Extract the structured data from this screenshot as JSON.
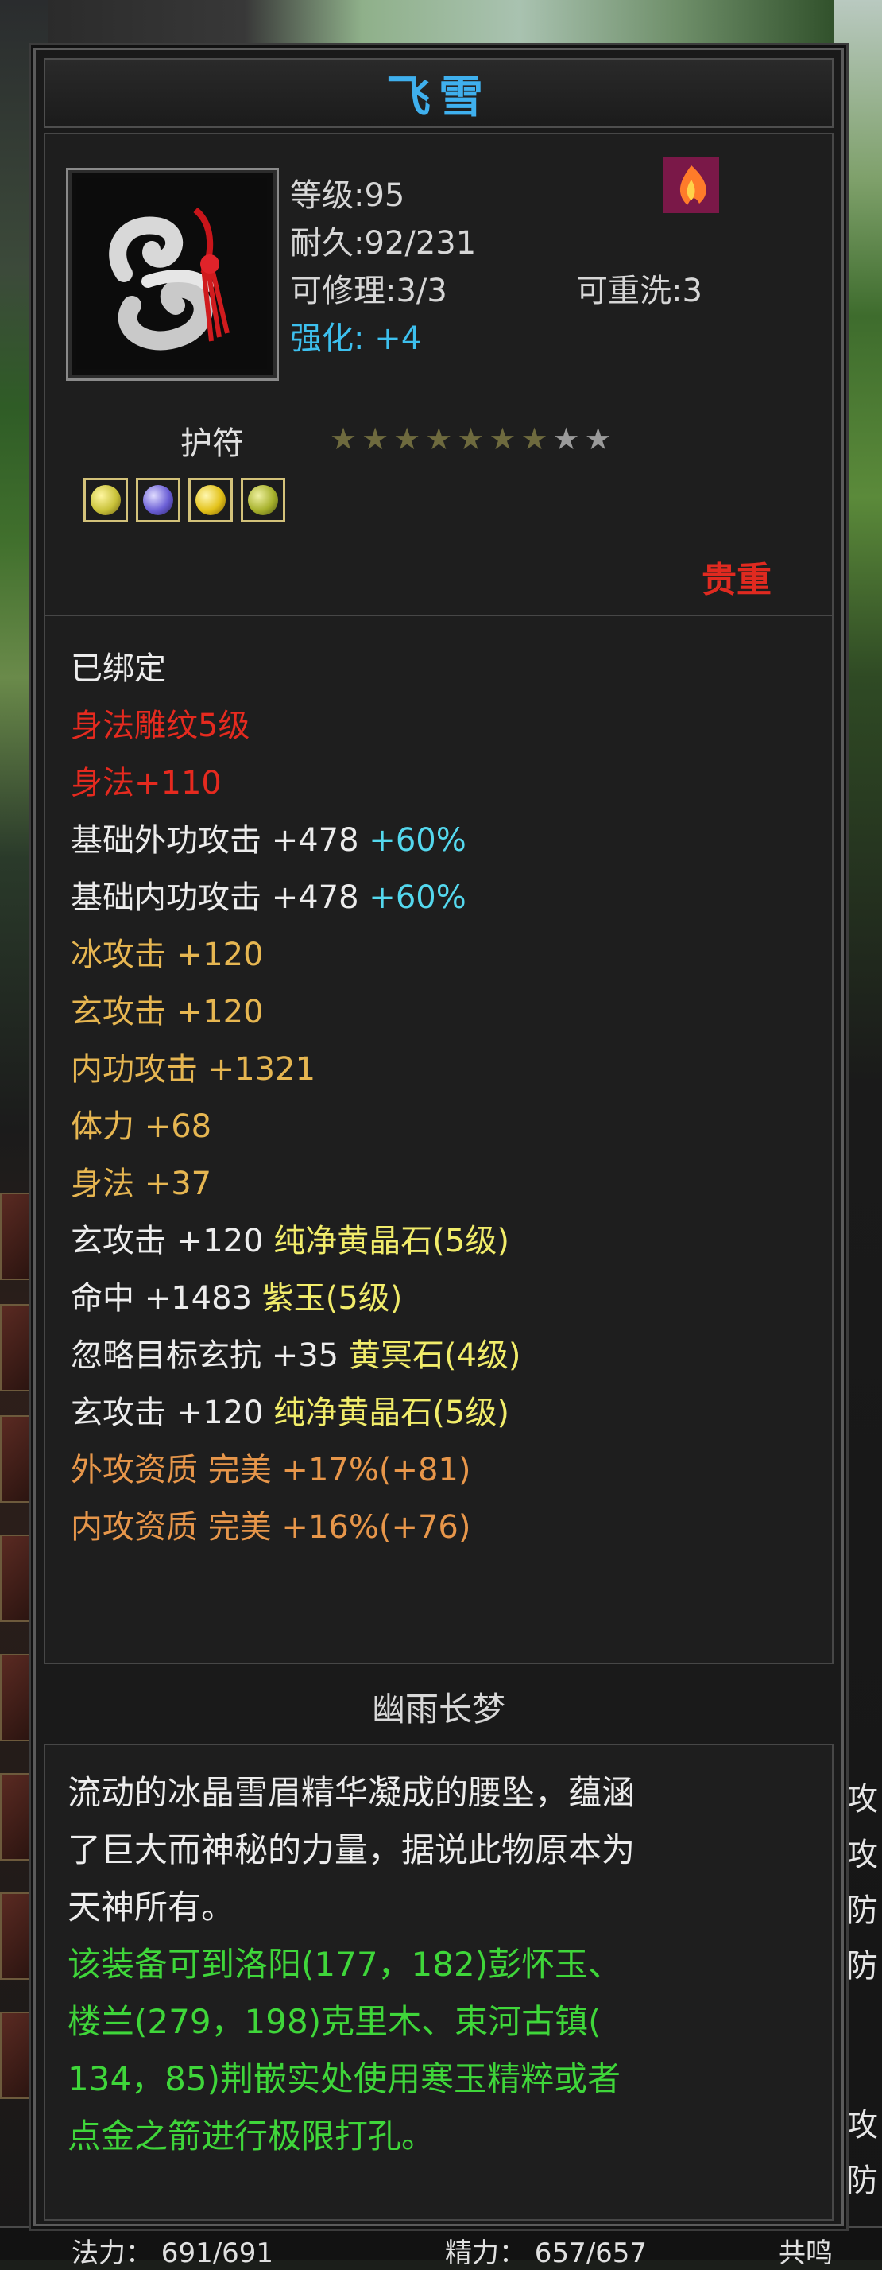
{
  "item": {
    "name": "飞雪",
    "level": "等级:95",
    "durability": "耐久:92/231",
    "repairable": "可修理:3/3",
    "rewashable": "可重洗:3",
    "enhance_label": "强化:",
    "enhance_value": "+4",
    "category": "护符",
    "stars_filled": 7,
    "stars_total": 9,
    "rarity": "贵重",
    "gems": [
      {
        "icon": "yellow-gem-icon",
        "color": "#c9c23a"
      },
      {
        "icon": "purple-gem-icon",
        "color": "#6b5fd6"
      },
      {
        "icon": "gold-gem-icon",
        "color": "#e3c21a"
      },
      {
        "icon": "green-gold-gem-icon",
        "color": "#a7b12c"
      }
    ]
  },
  "attributes": {
    "bound": "已绑定",
    "carving": "身法雕纹5级",
    "carving_bonus": "身法+110",
    "ext_atk": "基础外功攻击 +478",
    "ext_atk_pct": "+60%",
    "int_atk": "基础内功攻击 +478",
    "int_atk_pct": "+60%",
    "ice_atk": "冰攻击 +120",
    "mystic_atk": "玄攻击 +120",
    "inner_atk": "内功攻击 +1321",
    "stamina": "体力 +68",
    "agility": "身法 +37",
    "gem1_stat": "玄攻击 +120",
    "gem1_name": "纯净黄晶石(5级)",
    "gem2_stat": "命中 +1483",
    "gem2_name": "紫玉(5级)",
    "gem3_stat": "忽略目标玄抗 +35",
    "gem3_name": "黄冥石(4级)",
    "gem4_stat": "玄攻击 +120",
    "gem4_name": "纯净黄晶石(5级)",
    "aptitude_ext": "外攻资质  完美 +17%(+81)",
    "aptitude_int": "内攻资质  完美 +16%(+76)"
  },
  "description": {
    "set_name": "幽雨长梦",
    "lore_1": "流动的冰晶雪眉精华凝成的腰坠，蕴涵",
    "lore_2": "了巨大而神秘的力量，据说此物原本为",
    "lore_3": "天神所有。",
    "hint_1": "该装备可到洛阳(177，182)彭怀玉、",
    "hint_2": "楼兰(279，198)克里木、束河古镇(",
    "hint_3": "134，85)荆嵌实处使用寒玉精粹或者",
    "hint_4": "点金之箭进行极限打孔。"
  },
  "background": {
    "right_side_text": [
      "攻",
      "攻",
      "防",
      "防",
      "攻",
      "防"
    ],
    "bottom_stat_1": "法力：  691/691",
    "bottom_stat_2": "精力：  657/657",
    "bottom_stat_3": "共鸣"
  },
  "colors": {
    "title": "#3fb0ee",
    "enhance": "#3dc0ee",
    "carving_red": "#e52a1f",
    "stat_gold": "#e6b651",
    "percent_cyan": "#54d8ee",
    "gem_yellow": "#f1ec6a",
    "aptitude_orange": "#e7964a",
    "hint_green": "#3fd63a",
    "rarity_red": "#e02a20"
  }
}
